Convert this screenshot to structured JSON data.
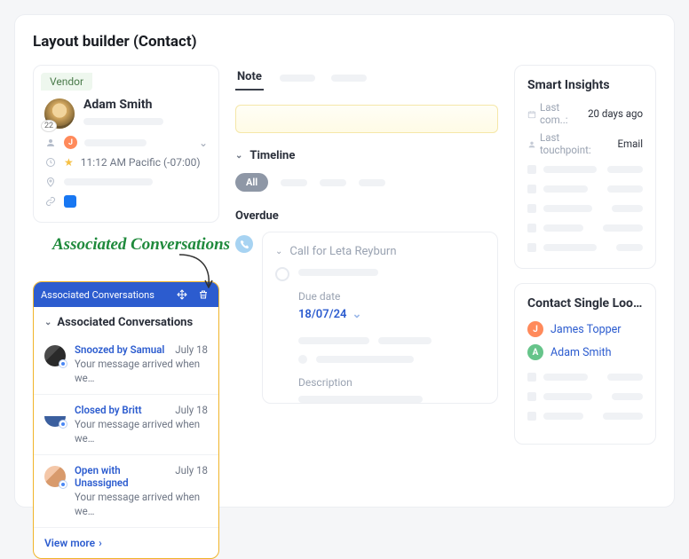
{
  "page_title": "Layout builder (Contact)",
  "contact": {
    "vendor_badge": "Vendor",
    "name": "Adam Smith",
    "avatar_count": "22",
    "owner_initial": "J",
    "time": "11:12 AM Pacific (-07:00)"
  },
  "annotation": "Associated Conversations",
  "widget": {
    "header": "Associated Conversations",
    "subtitle": "Associated Conversations",
    "items": [
      {
        "status": "Snoozed by Samual",
        "date": "July 18",
        "msg": "Your message arrived when we…"
      },
      {
        "status": "Closed by Britt",
        "date": "July 18",
        "msg": "Your message arrived when we…"
      },
      {
        "status": "Open with Unassigned",
        "date": "July 18",
        "msg": "Your message arrived when we…"
      }
    ],
    "view_more": "View more"
  },
  "mid": {
    "tab_note": "Note",
    "timeline": "Timeline",
    "pill_all": "All",
    "overdue": "Overdue",
    "call_title": "Call for Leta Reyburn",
    "due_date_label": "Due date",
    "due_date_value": "18/07/24",
    "description_label": "Description"
  },
  "right": {
    "insights_title": "Smart Insights",
    "kv": [
      {
        "k": "Last com..:",
        "v": "20 days ago"
      },
      {
        "k": "Last touchpoint:",
        "v": "Email"
      }
    ],
    "lookup_title": "Contact Single Loo…",
    "people": [
      {
        "initial": "J",
        "name": "James Topper",
        "cls": "j"
      },
      {
        "initial": "A",
        "name": "Adam Smith",
        "cls": "a"
      }
    ]
  }
}
